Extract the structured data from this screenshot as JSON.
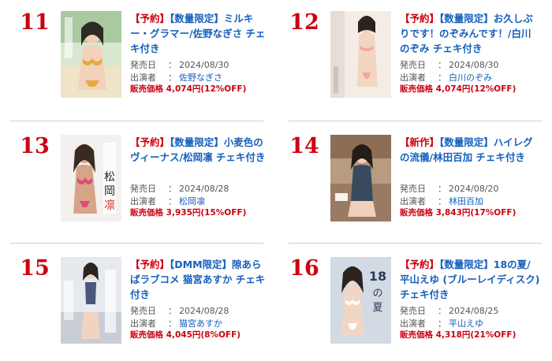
{
  "labels": {
    "release_date": "発売日",
    "performer": "出演者",
    "colon": "：",
    "price_prefix": "販売価格"
  },
  "items": [
    {
      "rank": "11",
      "tag": "【予約】",
      "title": "【数量限定】ミルキー・グラマー/佐野なぎさ チェキ付き",
      "release_date": "2024/08/30",
      "performer": "佐野なぎさ",
      "price": "4,074円(12%OFF)"
    },
    {
      "rank": "12",
      "tag": "【予約】",
      "title": "【数量限定】お久しぶりです！のぞみんです！/白川のぞみ チェキ付き",
      "release_date": "2024/08/30",
      "performer": "白川のぞみ",
      "price": "4,074円(12%OFF)"
    },
    {
      "rank": "13",
      "tag": "【予約】",
      "title": "【数量限定】小麦色のヴィーナス/松岡凛 チェキ付き",
      "release_date": "2024/08/28",
      "performer": "松岡凛",
      "price": "3,935円(15%OFF)"
    },
    {
      "rank": "14",
      "tag": "【新作】",
      "title": "【数量限定】ハイレグの流儀/林田百加 チェキ付き",
      "release_date": "2024/08/20",
      "performer": "林田百加",
      "price": "3,843円(17%OFF)"
    },
    {
      "rank": "15",
      "tag": "【予約】",
      "title": "【DMM限定】隙あらばラブコメ 猫宮あすか チェキ付き",
      "release_date": "2024/08/28",
      "performer": "猫宮あすか",
      "price": "4,045円(8%OFF)"
    },
    {
      "rank": "16",
      "tag": "【予約】",
      "title": "【数量限定】18の夏/平山えゆ (ブルーレイディスク) チェキ付き",
      "release_date": "2024/08/25",
      "performer": "平山えゆ",
      "price": "4,318円(21%OFF)"
    }
  ]
}
